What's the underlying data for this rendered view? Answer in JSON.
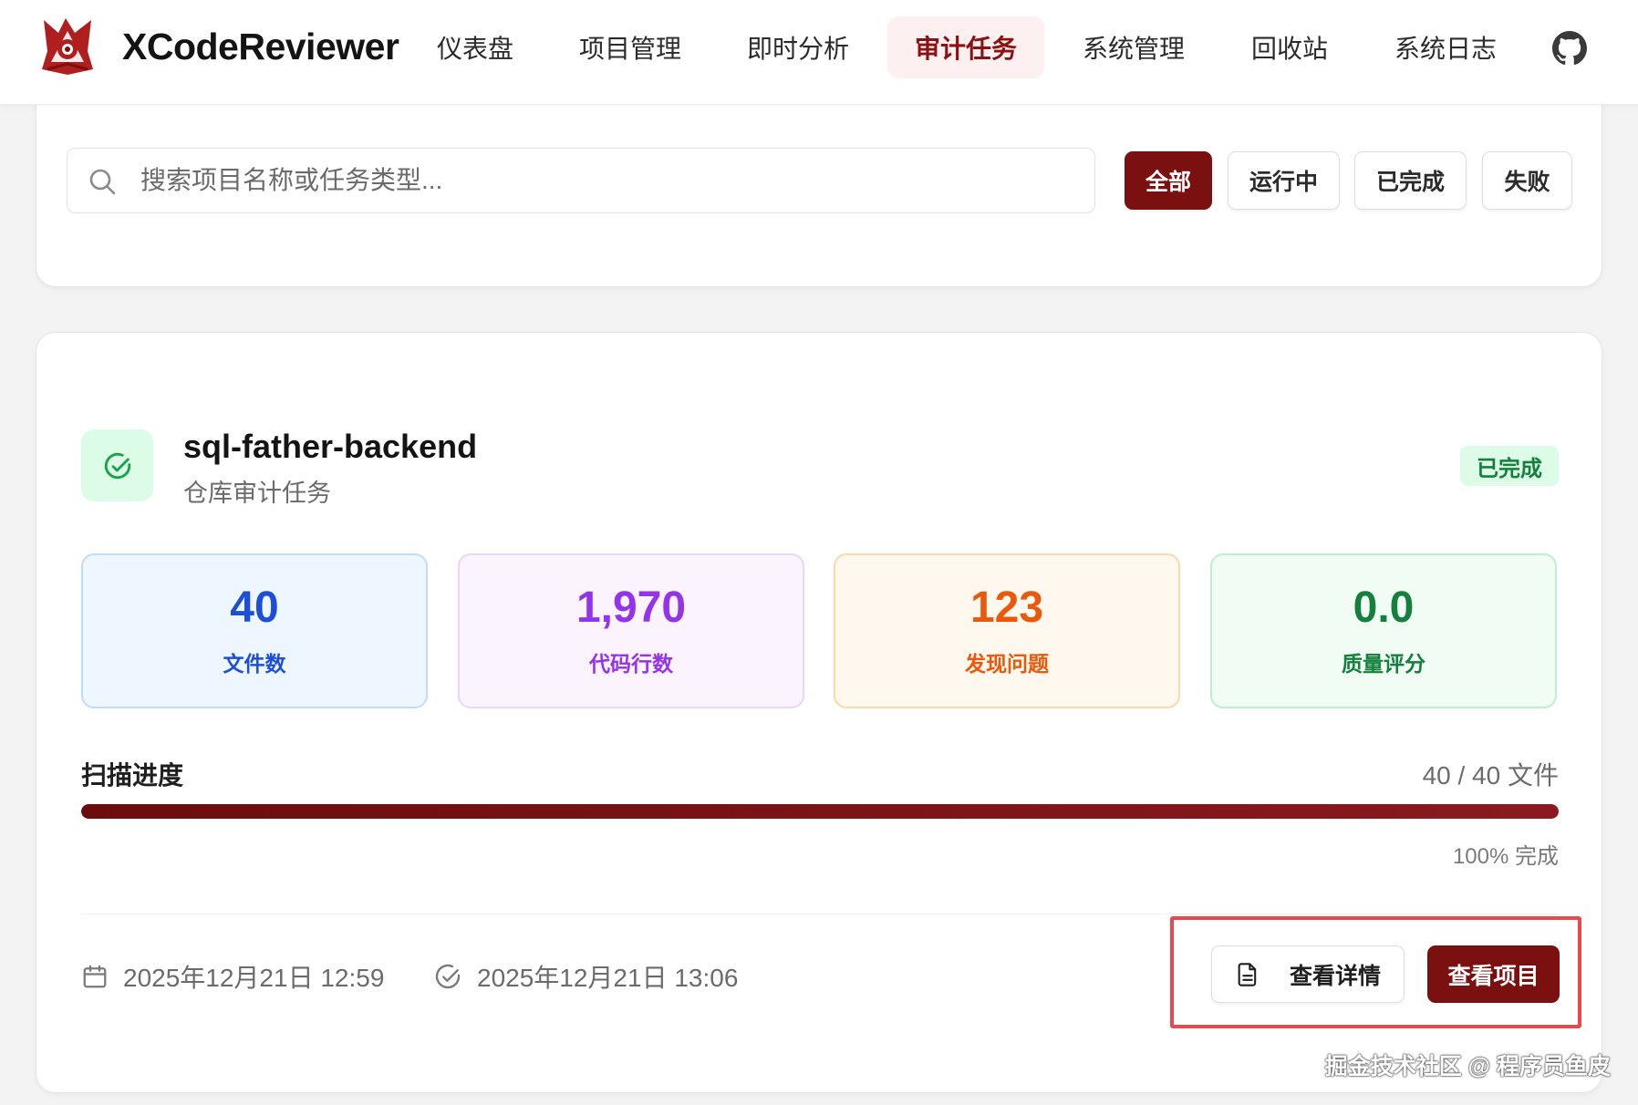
{
  "app": {
    "brand": "XCodeReviewer"
  },
  "nav": {
    "items": [
      "仪表盘",
      "项目管理",
      "即时分析",
      "审计任务",
      "系统管理",
      "回收站",
      "系统日志"
    ],
    "active": "审计任务"
  },
  "filter": {
    "search_placeholder": "搜索项目名称或任务类型...",
    "buttons": [
      "全部",
      "运行中",
      "已完成",
      "失败"
    ],
    "active": "全部"
  },
  "task": {
    "name": "sql-father-backend",
    "type": "仓库审计任务",
    "status": "已完成",
    "stats": {
      "files": {
        "value": "40",
        "label": "文件数",
        "color": "#1d4ed8"
      },
      "lines": {
        "value": "1,970",
        "label": "代码行数",
        "color": "#9333ea"
      },
      "issues": {
        "value": "123",
        "label": "发现问题",
        "color": "#ea580c"
      },
      "quality": {
        "value": "0.0",
        "label": "质量评分",
        "color": "#15803d"
      }
    },
    "progress": {
      "label": "扫描进度",
      "count": "40 / 40 文件",
      "percent": 100,
      "percent_text": "100% 完成"
    },
    "created_at": "2025年12月21日 12:59",
    "completed_at": "2025年12月21日 13:06",
    "actions": {
      "details": "查看详情",
      "project": "查看项目"
    }
  },
  "watermark": "掘金技术社区 @ 程序员鱼皮",
  "colors": {
    "accent": "#7a1010",
    "success": "#15803d",
    "highlight": "#e8494f"
  }
}
